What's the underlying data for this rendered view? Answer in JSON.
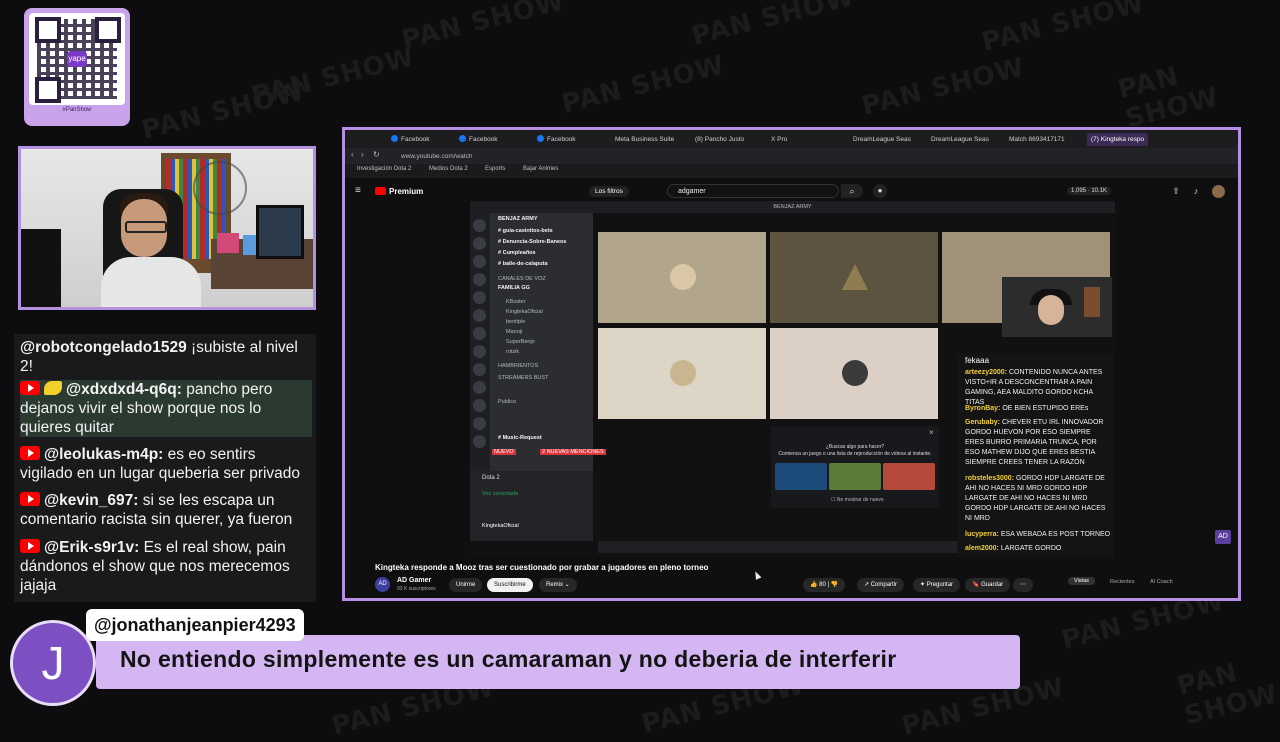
{
  "overlay": {
    "brand_watermark": "PAN SHOW",
    "qr_caption": "#PanShow"
  },
  "chat": [
    {
      "user": "@robotcongelado1529",
      "text": "¡subiste al nivel 2!",
      "badge": false
    },
    {
      "user": "@xdxdxd4-q6q:",
      "text": "pancho pero dejanos vivir el show porque nos lo quieres quitar",
      "badge": true,
      "emoji": true
    },
    {
      "user": "@leolukas-m4p:",
      "text": "es eo sentirs vigilado en un lugar queberia ser privado",
      "badge": true
    },
    {
      "user": "@kevin_697:",
      "text": "si se les escapa un comentario racista sin querer, ya fueron",
      "badge": true
    },
    {
      "user": "@Erik-s9r1v:",
      "text": "Es el real show, pain dándonos el show que nos merecemos jajaja",
      "badge": true
    }
  ],
  "banner": {
    "avatar_letter": "J",
    "username": "@jonathanjeanpier4293",
    "message": "No entiendo simplemente es un camaraman y no deberia de interferir"
  },
  "browser": {
    "tabs": [
      "Facebook",
      "Facebook",
      "Facebook",
      "Meta Business Suite",
      "(8) Pancho Justo",
      "X Pro",
      "DreamLeague Seas",
      "DreamLeague Seas",
      "Match 8693417171",
      "(7) Kingteka respo"
    ],
    "url": "www.youtube.com/watch",
    "bookmarks": [
      "Investigación Dota 2",
      "Medios Dota 2",
      "Esports",
      "Bajar Animes"
    ]
  },
  "youtube": {
    "logo": "Premium",
    "filters_label": "Los filtros",
    "search_value": "adgamer",
    "stats": "1,095 · 10.1K",
    "video_title": "Kingteka responde a Mooz tras ser cuestionado por grabar a jugadores en pleno torneo",
    "channel_name": "AD Gamer",
    "channel_subs": "93 K suscriptores",
    "join_label": "Unirme",
    "subscribe_label": "Suscribirme",
    "remix_label": "Remix",
    "likes": "80",
    "share_label": "Compartir",
    "ask_label": "Preguntar",
    "save_label": "Guardar",
    "right_tabs": [
      "Vistas",
      "Recientes",
      "AI Coach"
    ],
    "channel_avatar": "AD"
  },
  "discord": {
    "window_title": "BENJAZ ARMY",
    "server": "BENJAZ ARMY",
    "channels": [
      "guia-casinitos-bets",
      "Denuncia-Sobre-Baneos",
      "Cumpleaños",
      "baile-de-calaputa"
    ],
    "voice_header": "CANALES DE VOZ",
    "voice_channel": "FAMILIA GG",
    "members": [
      "KBuster",
      "KingtekaOficial",
      "benitple",
      "Manoji",
      "SuperBenjo",
      "rotzik"
    ],
    "cat2": "HAMBRIENTOS",
    "cat3": "STREAMERS BUST",
    "cat4": "Publico",
    "text_channel": "Music-Request",
    "voice_connected": "Voz conectada",
    "current": "Dota 2",
    "self_user": "KingtekaOficial",
    "popup_title": "¿Buscas algo para hacer?",
    "popup_sub": "Comienza un juego o una lista de reproducción de vídeos al instante.",
    "popup_check": "No mostrar de nuevo",
    "new_label": "NUEVO",
    "mentions_label": "2 NUEVAS MENCIONES"
  },
  "ytchat": {
    "header": "fekaaa",
    "messages": [
      {
        "user": "arteezy2000:",
        "text": "CONTENIDO NUNCA ANTES VISTO+IR A DESCONCENTRAR A PAIN GAMING, AEA MALDITO GORDO KCHA TITAS"
      },
      {
        "user": "ByronBay:",
        "text": "OE BIEN ESTUPIDO EREs"
      },
      {
        "user": "Gerubaby:",
        "text": "CHEVER ETU IRL INNOVADOR GORDO HUEVON POR ESO SIEMPRE ERES BURRO PRIMARIA TRUNCA, POR ESO MATHEW DIJO QUE ERES BESTIA SIEMPRE CREES TENER LA RAZÓN"
      },
      {
        "user": "robsteles3000:",
        "text": "GORDO HDP LARGATE DE AHI NO HACES NI MRD GORDO HDP LARGATE DE AHI NO HACES NI MRD GORDO HDP LARGATE DE AHI NO HACES NI MRD"
      },
      {
        "user": "lucyperra:",
        "text": "ESA WEBADA ES POST TORNEO"
      },
      {
        "user": "alem2000:",
        "text": "LARGATE GORDO"
      }
    ]
  },
  "colors": {
    "accent": "#b590e0",
    "banner": "#d4b6f3",
    "yt_red": "#ff0000"
  }
}
